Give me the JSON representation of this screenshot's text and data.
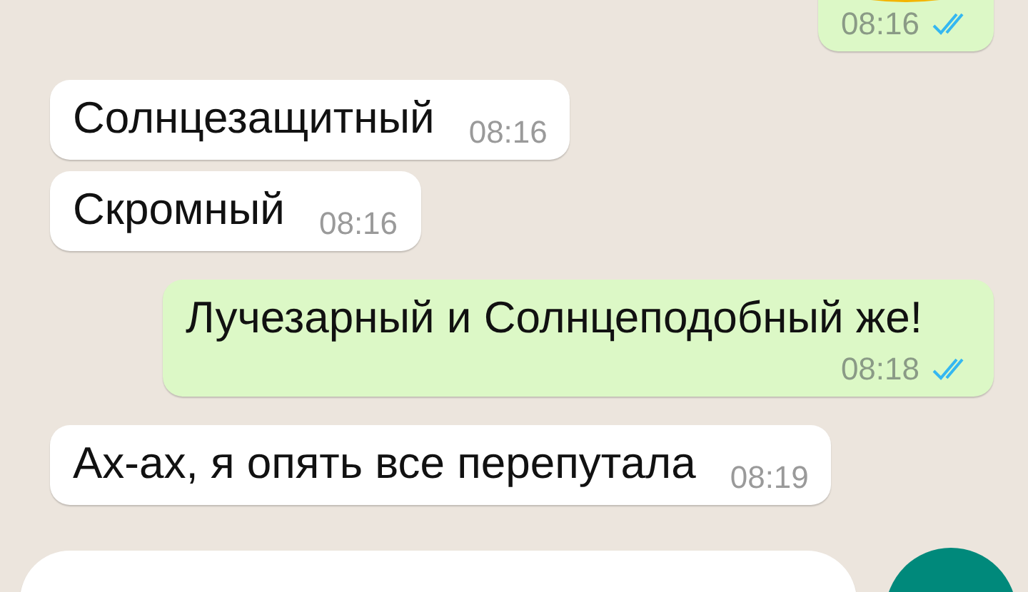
{
  "messages": [
    {
      "kind": "out",
      "time": "08:16",
      "read": true,
      "emoji": true
    },
    {
      "kind": "in",
      "text": "Солнцезащитный",
      "time": "08:16"
    },
    {
      "kind": "in",
      "text": "Скромный",
      "time": "08:16"
    },
    {
      "kind": "out",
      "text": "Лучезарный и Солнцеподобный же!",
      "time": "08:18",
      "read": true
    },
    {
      "kind": "in",
      "text": "Ах-ах, я опять все перепутала",
      "time": "08:19"
    }
  ]
}
